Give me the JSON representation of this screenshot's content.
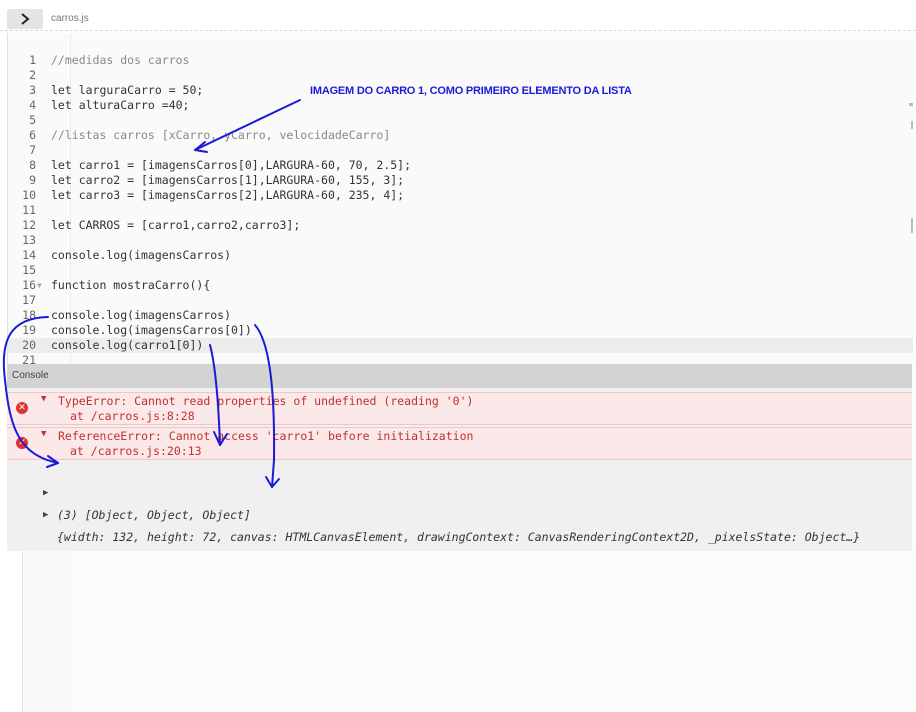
{
  "tabs": {
    "file_name": "carros.js"
  },
  "editor": {
    "lines": [
      {
        "n": "1",
        "text": "//medidas dos carros"
      },
      {
        "n": "2",
        "text": ""
      },
      {
        "n": "3",
        "text": "let larguraCarro = 50;"
      },
      {
        "n": "4",
        "text": "let alturaCarro =40;"
      },
      {
        "n": "5",
        "text": ""
      },
      {
        "n": "6",
        "text": "//listas carros [xCarro, yCarro, velocidadeCarro]"
      },
      {
        "n": "7",
        "text": ""
      },
      {
        "n": "8",
        "text": "let carro1 = [imagensCarros[0],LARGURA-60, 70, 2.5];"
      },
      {
        "n": "9",
        "text": "let carro2 = [imagensCarros[1],LARGURA-60, 155, 3];"
      },
      {
        "n": "10",
        "text": "let carro3 = [imagensCarros[2],LARGURA-60, 235, 4];"
      },
      {
        "n": "11",
        "text": ""
      },
      {
        "n": "12",
        "text": "let CARROS = [carro1,carro2,carro3];"
      },
      {
        "n": "13",
        "text": ""
      },
      {
        "n": "14",
        "text": "console.log(imagensCarros)"
      },
      {
        "n": "15",
        "text": ""
      },
      {
        "n": "16",
        "text": "function mostraCarro(){"
      },
      {
        "n": "17",
        "text": ""
      },
      {
        "n": "18",
        "text": "console.log(imagensCarros)"
      },
      {
        "n": "19",
        "text": "console.log(imagensCarros[0])"
      },
      {
        "n": "20",
        "text": "console.log(carro1[0])"
      },
      {
        "n": "21",
        "text": ""
      }
    ]
  },
  "console": {
    "title": "Console",
    "errors": [
      {
        "message": "TypeError: Cannot read properties of undefined (reading '0')",
        "location": "at /carros.js:8:28"
      },
      {
        "message": "ReferenceError: Cannot access 'carro1' before initialization",
        "location": "at /carros.js:20:13"
      }
    ],
    "logs": [
      {
        "text": "(3) [Object, Object, Object]"
      },
      {
        "text": "{width: 132, height: 72, canvas: HTMLCanvasElement, drawingContext: CanvasRenderingContext2D, _pixelsState: Object…}"
      }
    ]
  },
  "annotation": {
    "text": "IMAGEM DO CARRO 1, COMO PRIMEIRO ELEMENTO DA LISTA",
    "color": "#1a1ad8"
  },
  "icons": {
    "run": "chevron-right-icon",
    "error": "error-circle-icon",
    "expand": "triangle-expand-icon"
  }
}
